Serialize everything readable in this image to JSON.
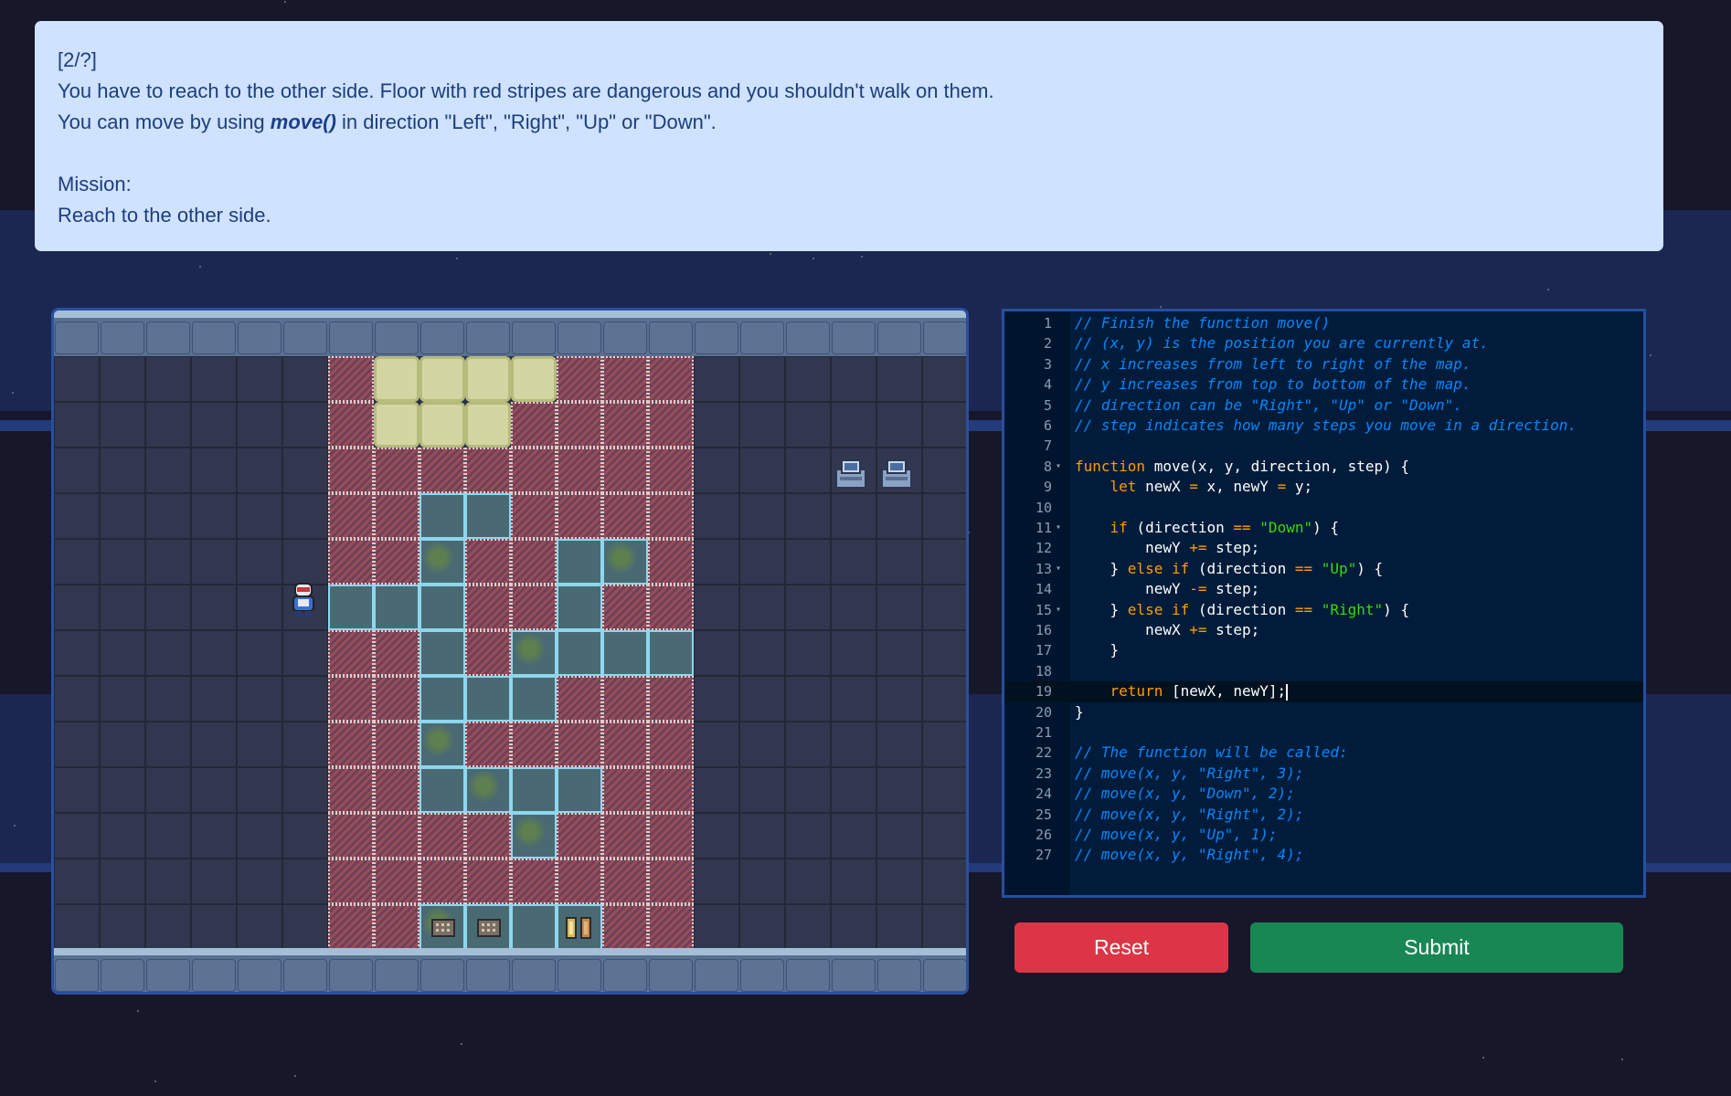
{
  "instructions": {
    "level": "[2/?]",
    "line1": "You have to reach to the other side. Floor with red stripes are dangerous and you shouldn't walk on them.",
    "line2_pre": "You can move by using ",
    "line2_fn": "move()",
    "line2_post": " in direction \"Left\", \"Right\", \"Up\" or \"Down\".",
    "mission_label": "Mission:",
    "mission_text": "Reach to the other side."
  },
  "game": {
    "grid": [
      "......HGGGGHHH......",
      "......HGGGHHHH......",
      "......HHHHHHHH......",
      "......HHSSHHHH......",
      "......HHSHHSSH......",
      "......SSSHHSHH......",
      "......HHSHSSSS......",
      "......HHSSSHHH......",
      "......HHSHHHHH......",
      "......HHSSSSHH......",
      "......HHHHSHHH......",
      "......HHHHHHHH......",
      "......HHSSSSHH......"
    ],
    "player_icon": "player-robot-icon",
    "computer_icons": [
      "computer-terminal-icon",
      "computer-terminal-icon"
    ],
    "floor_items": [
      "chip-icon",
      "chip-icon",
      "battery-icon"
    ]
  },
  "editor": {
    "lines": [
      "// Finish the function move()",
      "// (x, y) is the position you are currently at.",
      "// x increases from left to right of the map.",
      "// y increases from top to bottom of the map.",
      "// direction can be \"Right\", \"Up\" or \"Down\".",
      "// step indicates how many steps you move in a direction.",
      "",
      "function move(x, y, direction, step) {",
      "    let newX = x, newY = y;",
      "",
      "    if (direction == \"Down\") {",
      "        newY += step;",
      "    } else if (direction == \"Up\") {",
      "        newY -= step;",
      "    } else if (direction == \"Right\") {",
      "        newX += step;",
      "    }",
      "",
      "    return [newX, newY];",
      "}",
      "",
      "// The function will be called:",
      "// move(x, y, \"Right\", 3);",
      "// move(x, y, \"Down\", 2);",
      "// move(x, y, \"Right\", 2);",
      "// move(x, y, \"Up\", 1);",
      "// move(x, y, \"Right\", 4);"
    ],
    "fold_lines": [
      8,
      11,
      13,
      15
    ],
    "active_line": 19
  },
  "buttons": {
    "reset": "Reset",
    "submit": "Submit"
  },
  "colors": {
    "instructions_bg": "#cfe2ff",
    "reset": "#dc3545",
    "submit": "#198754",
    "editor_bg": "#001c3a"
  }
}
